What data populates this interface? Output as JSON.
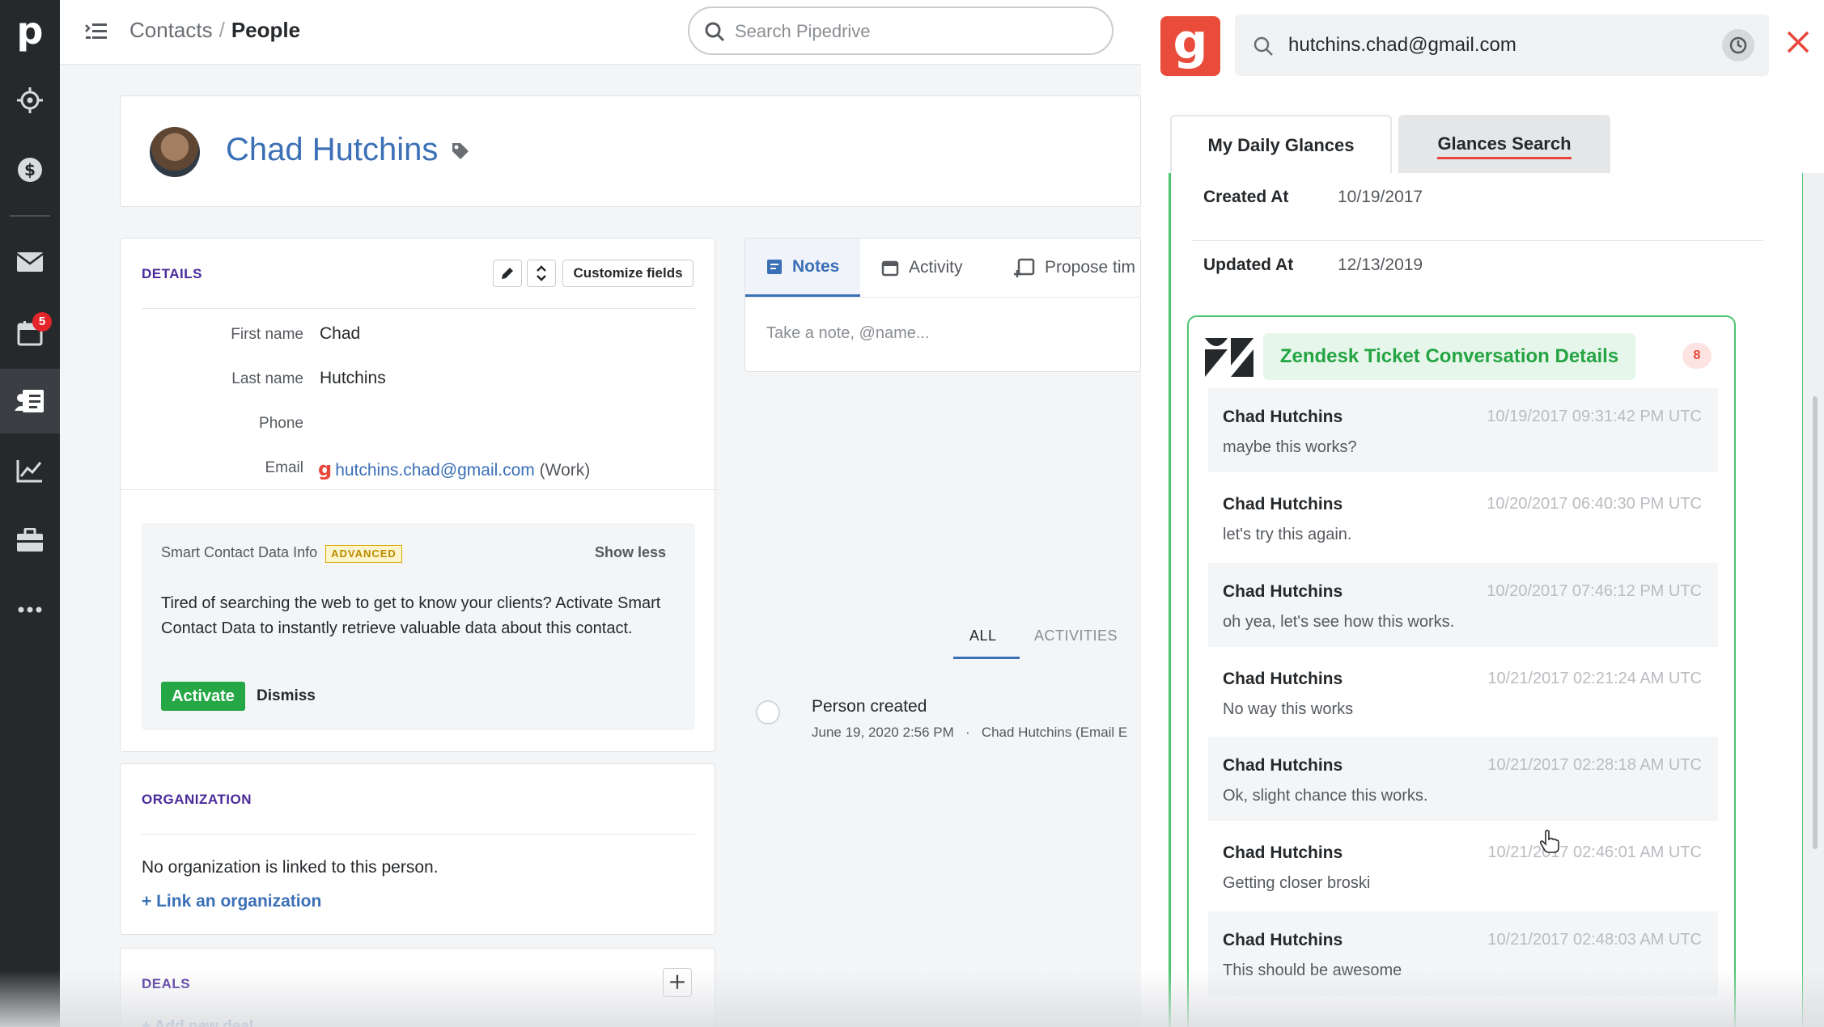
{
  "nav": {
    "logo": "p",
    "items": [
      {
        "icon": "target-icon",
        "label": "Leads"
      },
      {
        "icon": "dollar-icon",
        "label": "Deals"
      },
      {
        "icon": "mail-icon",
        "label": "Mail"
      },
      {
        "icon": "calendar-icon",
        "label": "Activities",
        "badge": "5"
      },
      {
        "icon": "contacts-icon",
        "label": "Contacts",
        "active": true
      },
      {
        "icon": "chart-icon",
        "label": "Insights"
      },
      {
        "icon": "briefcase-icon",
        "label": "Products"
      },
      {
        "icon": "more-icon",
        "label": "More"
      }
    ],
    "activities_badge": "5"
  },
  "header": {
    "breadcrumb_parent": "Contacts",
    "breadcrumb_sep": "/",
    "breadcrumb_current": "People",
    "search_placeholder": "Search Pipedrive"
  },
  "person": {
    "name": "Chad Hutchins"
  },
  "details": {
    "title": "DETAILS",
    "customize_label": "Customize fields",
    "fields": [
      {
        "label": "First name",
        "value": "Chad"
      },
      {
        "label": "Last name",
        "value": "Hutchins"
      },
      {
        "label": "Phone",
        "value": ""
      },
      {
        "label": "Email",
        "value": "hutchins.chad@gmail.com",
        "suffix": "(Work)"
      }
    ],
    "smart": {
      "title": "Smart Contact Data Info",
      "badge": "ADVANCED",
      "show_less": "Show less",
      "body": "Tired of searching the web to get to know your clients? Activate Smart Contact Data to instantly retrieve valuable data about this contact.",
      "activate": "Activate",
      "dismiss": "Dismiss"
    }
  },
  "organization": {
    "title": "ORGANIZATION",
    "empty_text": "No organization is linked to this person.",
    "link_label": "+ Link an organization"
  },
  "deals": {
    "title": "DEALS",
    "add_label": "+ Add new deal"
  },
  "composer": {
    "tabs": [
      "Notes",
      "Activity",
      "Propose tim"
    ],
    "placeholder": "Take a note, @name..."
  },
  "history": {
    "tabs": [
      "ALL",
      "ACTIVITIES"
    ],
    "event_title": "Person created",
    "event_date": "June 19, 2020 2:56 PM",
    "event_dot": "·",
    "event_by": "Chad Hutchins (Email E"
  },
  "glances": {
    "logo": "g",
    "search_value": "hutchins.chad@gmail.com",
    "tabs": [
      "My Daily Glances",
      "Glances Search"
    ],
    "created_label": "Created At",
    "created_value": "10/19/2017",
    "updated_label": "Updated At",
    "updated_value": "12/13/2019",
    "zendesk_title": "Zendesk Ticket Conversation Details",
    "zendesk_count": "8",
    "messages": [
      {
        "who": "Chad Hutchins",
        "when": "10/19/2017 09:31:42 PM UTC",
        "text": "maybe this works?"
      },
      {
        "who": "Chad Hutchins",
        "when": "10/20/2017 06:40:30 PM UTC",
        "text": "let's try this again."
      },
      {
        "who": "Chad Hutchins",
        "when": "10/20/2017 07:46:12 PM UTC",
        "text": "oh yea, let's see how this works."
      },
      {
        "who": "Chad Hutchins",
        "when": "10/21/2017 02:21:24 AM UTC",
        "text": "No way this works"
      },
      {
        "who": "Chad Hutchins",
        "when": "10/21/2017 02:28:18 AM UTC",
        "text": "Ok, slight chance this works."
      },
      {
        "who": "Chad Hutchins",
        "when": "10/21/2017 02:46:01 AM UTC",
        "text": "Getting closer broski"
      },
      {
        "who": "Chad Hutchins",
        "when": "10/21/2017 02:48:03 AM UTC",
        "text": "This should be awesome"
      }
    ]
  },
  "colors": {
    "rail": "#26292c",
    "link_blue": "#3b6fb6",
    "accent_green": "#25a745",
    "glances_red": "#ea4c3b",
    "zendesk_green": "#4cc46e"
  }
}
